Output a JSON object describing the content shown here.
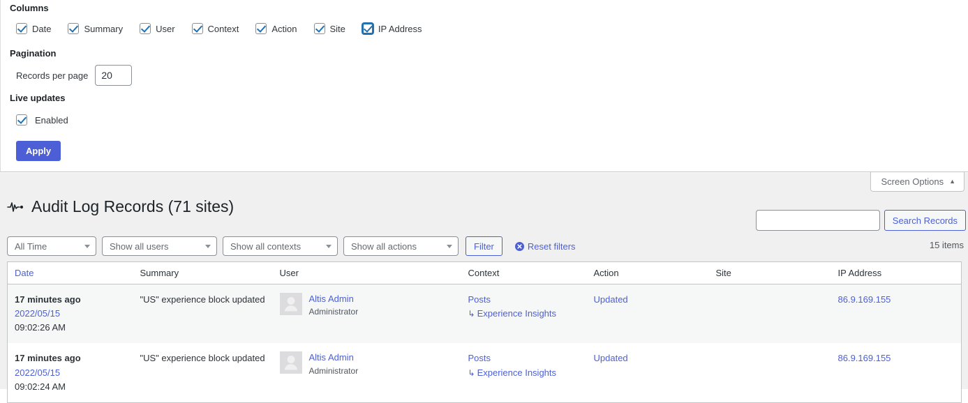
{
  "screen_options": {
    "columns_title": "Columns",
    "columns": [
      {
        "label": "Date",
        "checked": true,
        "focused": false
      },
      {
        "label": "Summary",
        "checked": true,
        "focused": false
      },
      {
        "label": "User",
        "checked": true,
        "focused": false
      },
      {
        "label": "Context",
        "checked": true,
        "focused": false
      },
      {
        "label": "Action",
        "checked": true,
        "focused": false
      },
      {
        "label": "Site",
        "checked": true,
        "focused": false
      },
      {
        "label": "IP Address",
        "checked": true,
        "focused": true
      }
    ],
    "pagination_title": "Pagination",
    "records_per_page_label": "Records per page",
    "records_per_page_value": "20",
    "live_updates_title": "Live updates",
    "live_updates_label": "Enabled",
    "live_updates_checked": true,
    "apply_label": "Apply",
    "tab_label": "Screen Options",
    "tab_caret": "▲"
  },
  "header": {
    "title": "Audit Log Records (71 sites)",
    "icon": "activity-waveform-icon"
  },
  "search": {
    "value": "",
    "placeholder": "",
    "button_label": "Search Records"
  },
  "filters": {
    "time": "All Time",
    "users": "Show all users",
    "contexts": "Show all contexts",
    "actions": "Show all actions",
    "filter_button": "Filter",
    "reset_label": "Reset filters",
    "reset_icon": "reset-circle-x-icon",
    "items_count": "15 items"
  },
  "table": {
    "columns": [
      {
        "label": "Date",
        "sorted": true
      },
      {
        "label": "Summary",
        "sorted": false
      },
      {
        "label": "User",
        "sorted": false
      },
      {
        "label": "Context",
        "sorted": false
      },
      {
        "label": "Action",
        "sorted": false
      },
      {
        "label": "Site",
        "sorted": false
      },
      {
        "label": "IP Address",
        "sorted": false
      }
    ],
    "rows": [
      {
        "date_relative": "17 minutes ago",
        "date_date": "2022/05/15",
        "date_time": "09:02:26 AM",
        "summary": "\"US\" experience block updated",
        "user_name": "Altis Admin",
        "user_role": "Administrator",
        "context": "Posts",
        "context_sub": "Experience Insights",
        "context_sub_arrow": "↳",
        "action": "Updated",
        "site": "",
        "ip": "86.9.169.155"
      },
      {
        "date_relative": "17 minutes ago",
        "date_date": "2022/05/15",
        "date_time": "09:02:24 AM",
        "summary": "\"US\" experience block updated",
        "user_name": "Altis Admin",
        "user_role": "Administrator",
        "context": "Posts",
        "context_sub": "Experience Insights",
        "context_sub_arrow": "↳",
        "action": "Updated",
        "site": "",
        "ip": "86.9.169.155"
      }
    ]
  },
  "colors": {
    "accent": "#4c5fd7",
    "text": "#2c3338",
    "muted": "#646970",
    "page_bg": "#f0f0f1",
    "row_alt": "#f6f7f7",
    "border": "#c3c4c7"
  }
}
